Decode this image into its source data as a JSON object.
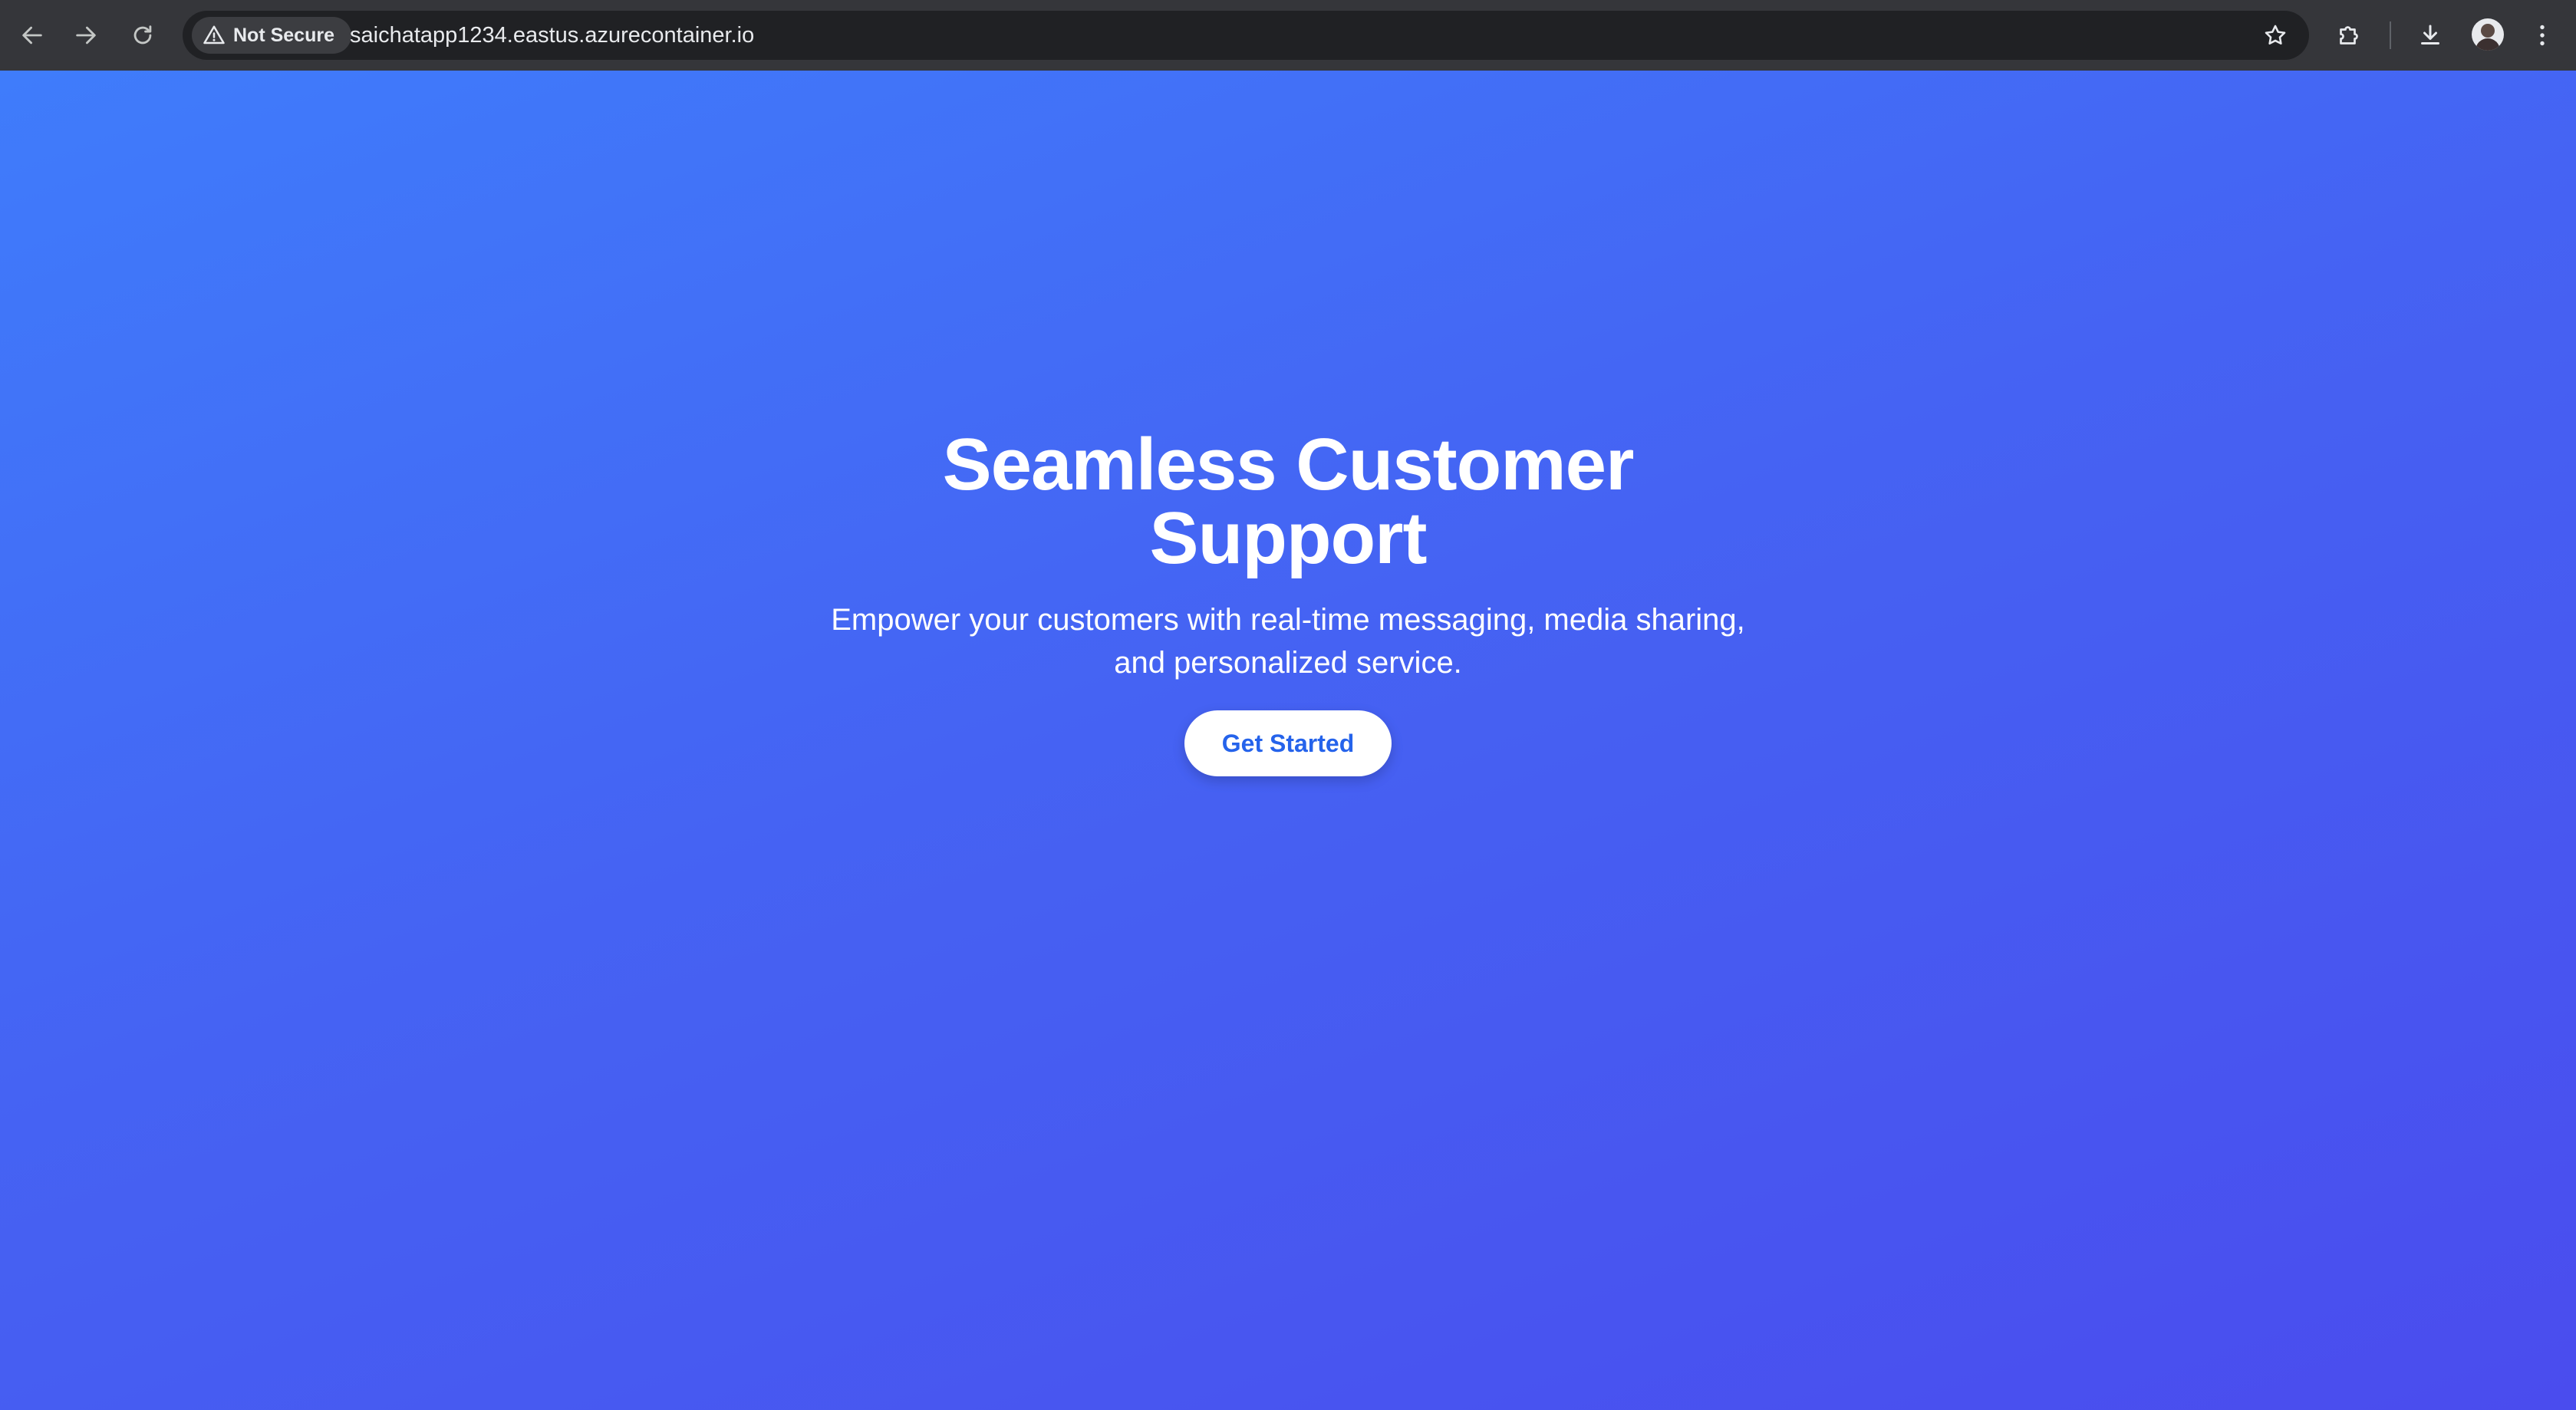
{
  "browser": {
    "security_label": "Not Secure",
    "url": "saichatapp1234.eastus.azurecontainer.io",
    "icons": {
      "back": "arrow-left-icon",
      "forward": "arrow-right-icon",
      "reload": "reload-icon",
      "security": "warning-triangle-icon",
      "bookmark": "star-icon",
      "extensions": "puzzle-icon",
      "downloads": "download-icon",
      "profile": "avatar",
      "menu": "kebab-menu-icon"
    }
  },
  "hero": {
    "title": "Seamless Customer Support",
    "subtitle": "Empower your customers with real-time messaging, media sharing, and personalized service.",
    "cta_label": "Get Started"
  },
  "colors": {
    "chrome_bg": "#35363a",
    "omnibox_bg": "#202124",
    "gradient_start": "#3f7cfb",
    "gradient_end": "#4a4cee",
    "cta_text": "#2563eb",
    "white": "#ffffff"
  }
}
